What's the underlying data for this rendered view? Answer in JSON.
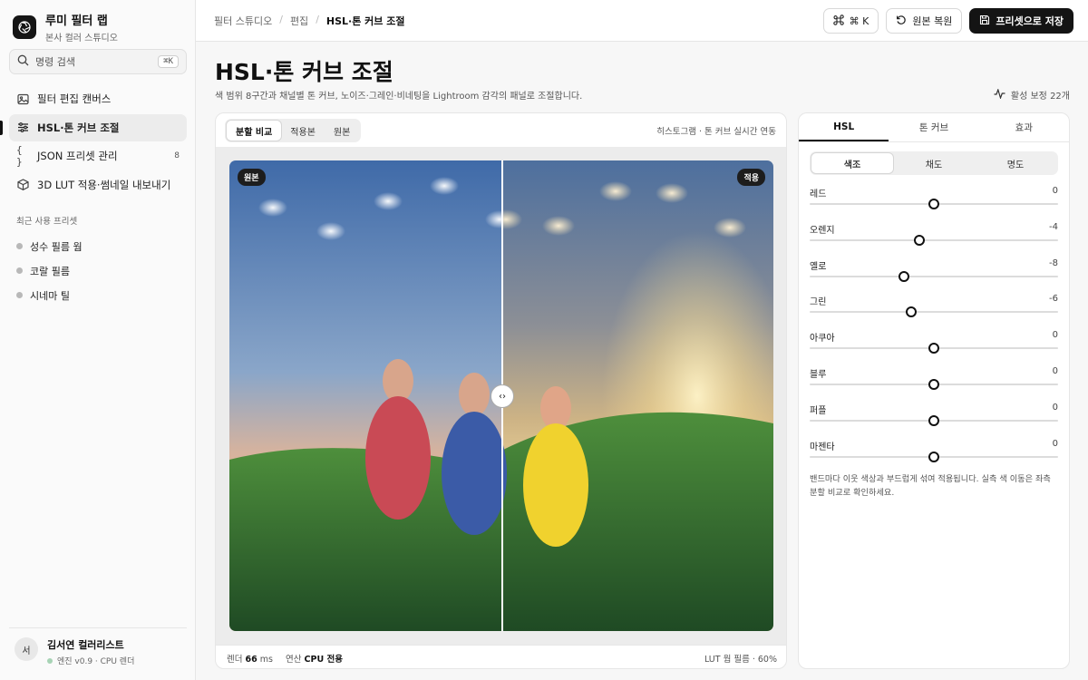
{
  "brand": {
    "title": "루미 필터 랩",
    "subtitle": "본사 컬러 스튜디오"
  },
  "command": {
    "placeholder": "명령 검색",
    "shortcut": "⌘K"
  },
  "nav": [
    {
      "label": "필터 편집 캔버스",
      "icon": "image-icon",
      "badge": ""
    },
    {
      "label": "HSL·톤 커브 조절",
      "icon": "sliders-icon",
      "badge": "",
      "active": true
    },
    {
      "label": "JSON 프리셋 관리",
      "icon": "braces-icon",
      "badge": "8"
    },
    {
      "label": "3D LUT 적용·썸네일 내보내기",
      "icon": "cube-icon",
      "badge": ""
    }
  ],
  "recent": {
    "title": "최근 사용 프리셋",
    "items": [
      "성수 필름 웜",
      "코랄 필름",
      "시네마 틸"
    ]
  },
  "user": {
    "initial": "서",
    "name": "김서연 컬러리스트",
    "status": "엔진 v0.9 · CPU 렌더"
  },
  "breadcrumb": {
    "root": "필터 스튜디오",
    "mid": "편집",
    "current": "HSL·톤 커브 조절",
    "sep": "/"
  },
  "topbar": {
    "shortcut_label": "⌘ K",
    "restore_label": "원본 복원",
    "save_label": "프리셋으로 저장"
  },
  "page": {
    "title": "HSL·톤 커브 조절",
    "description": "색 범위 8구간과 채널별 톤 커브, 노이즈·그레인·비네팅을 Lightroom 감각의 패널로 조절합니다.",
    "active_count": "활성 보정 22개"
  },
  "preview": {
    "modes": [
      "분할 비교",
      "적용본",
      "원본"
    ],
    "selected_mode": "분할 비교",
    "sync_text": "히스토그램 · 톤 커브 실시간 연동",
    "left_tag": "원본",
    "right_tag": "적용",
    "split_position": 0.5,
    "handle_glyph": "‹›",
    "render_label": "렌더",
    "render_ms": "66",
    "render_unit": "ms",
    "compute_label": "연산",
    "compute_value": "CPU 전용",
    "lut_text": "LUT 웜 필름 · 60%"
  },
  "panel": {
    "tabs": [
      "HSL",
      "톤 커브",
      "효과"
    ],
    "selected_tab": "HSL",
    "subtabs": [
      "색조",
      "채도",
      "명도"
    ],
    "selected_subtab": "색조",
    "sliders": [
      {
        "label": "레드",
        "value": 0
      },
      {
        "label": "오렌지",
        "value": -4
      },
      {
        "label": "옐로",
        "value": -8
      },
      {
        "label": "그린",
        "value": -6
      },
      {
        "label": "아쿠아",
        "value": 0
      },
      {
        "label": "블루",
        "value": 0
      },
      {
        "label": "퍼플",
        "value": 0
      },
      {
        "label": "마젠타",
        "value": 0
      }
    ],
    "slider_range": [
      -100,
      100
    ],
    "note": "밴드마다 이웃 색상과 부드럽게 섞여 적용됩니다. 실측 색 이동은 좌측 분할 비교로 확인하세요."
  }
}
